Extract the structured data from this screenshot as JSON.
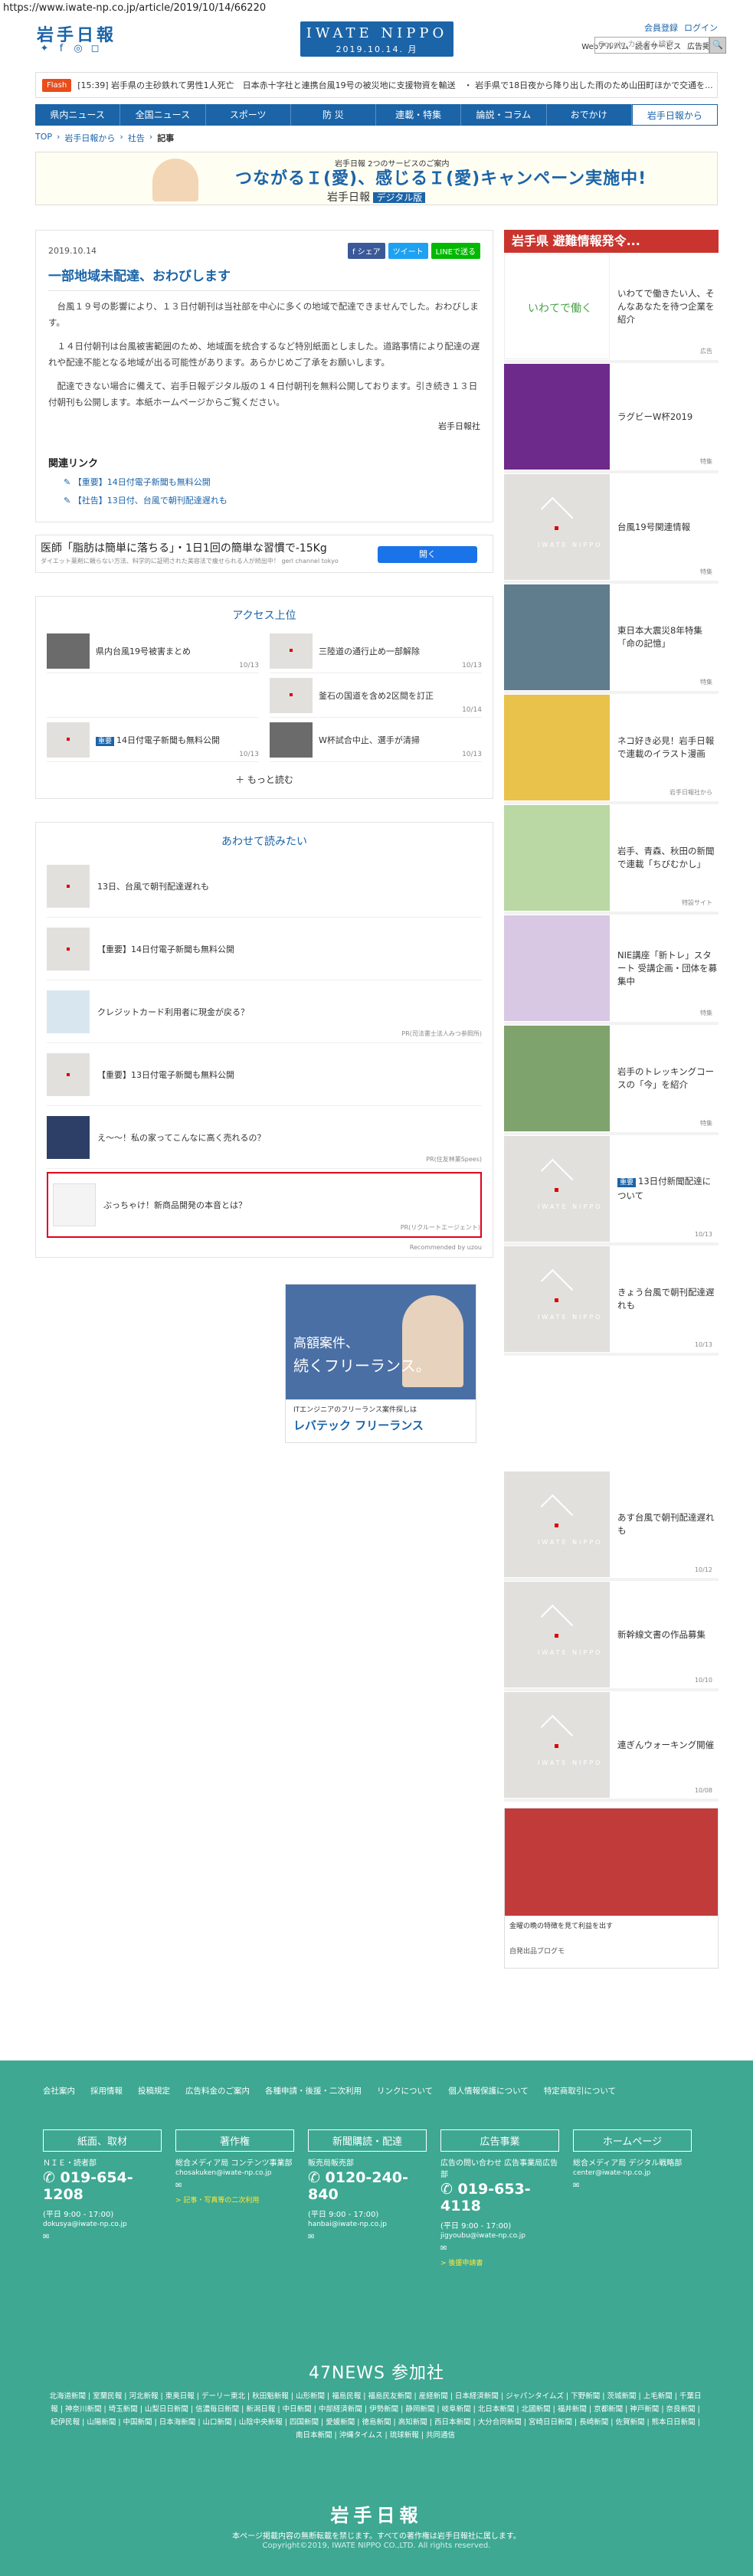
{
  "url": "https://www.iwate-np.co.jp/article/2019/10/14/66220",
  "header": {
    "logo_text": "岩手日報",
    "center_title": "IWATE NIPPO",
    "center_date": "2019.10.14. 月",
    "top_links": [
      "会員登録",
      "ログイン"
    ],
    "sub_links": [
      "Webアルバム",
      "読者サービス",
      "広告掲載"
    ],
    "search_placeholder": "Google カスタム検索",
    "search_button": "🔍"
  },
  "flash": {
    "label": "Flash",
    "text": "[15:39] 岩手県の主砂鉄れて男性1人死亡　日本赤十字社と連携台風19号の被災地に支援物資を輸送　・ 岩手県で18日夜から降り出した雨のため山田町ほかで交通を..."
  },
  "nav": {
    "items": [
      "県内ニュース",
      "全国ニュース",
      "スポーツ",
      "防 災",
      "連載・特集",
      "論説・コラム",
      "おでかけ",
      "岩手日報から"
    ],
    "active_index": 7
  },
  "breadcrumb": [
    "TOP",
    "岩手日報から",
    "社告",
    "記事"
  ],
  "banner": {
    "small": "岩手日報 2つのサービスのご案内",
    "main": "つながるＩ(愛)、感じるＩ(愛)キャンペーン実施中!",
    "sub_logo": "岩手日報",
    "sub_tag": "デジタル版"
  },
  "article": {
    "date": "2019.10.14",
    "share": [
      "f シェア",
      "ツイート",
      "LINEで送る"
    ],
    "title": "一部地域未配達、おわびします",
    "paragraphs": [
      "台風１９号の影響により、１３日付朝刊は当社部を中心に多くの地域で配達できませんでした。おわびします。",
      "１４日付朝刊は台風被害範囲のため、地域面を統合するなど特別紙面としました。道路事情により配達の遅れや配達不能となる地域が出る可能性があります。あらかじめご了承をお願いします。",
      "配達できない場合に備えて、岩手日報デジタル版の１４日付朝刊を無料公開しております。引き続き１３日付朝刊も公開します。本紙ホームページからご覧ください。"
    ],
    "signature": "岩手日報社",
    "related_title": "関連リンク",
    "related": [
      "【重要】14日付電子新聞も無料公開",
      "【社告】13日付、台風で朝刊配達遅れも"
    ]
  },
  "ad_strip": {
    "headline": "医師「脂肪は簡単に落ちる」・1日1回の簡単な習慣で-15Kg",
    "sub": "ダイエット薬剤に頼らない方法、科学的に証明された美容法で痩せられる人が続出中！ gerl channel tokyo",
    "button": "開く"
  },
  "access": {
    "title": "アクセス上位",
    "items": [
      {
        "text": "県内台風19号被害まとめ",
        "date": "10/13"
      },
      {
        "text": "三陸道の通行止め一部解除",
        "date": "10/13"
      },
      {
        "text": "",
        "date": ""
      },
      {
        "text": "釜石の国道を含め2区間を訂正",
        "date": "10/14"
      },
      {
        "text": "14日付電子新聞も無料公開",
        "date": "10/13",
        "badge": "重要"
      },
      {
        "text": "W杯試合中止、選手が清掃",
        "date": "10/13"
      }
    ],
    "more": "もっと読む"
  },
  "recommend": {
    "title": "あわせて読みたい",
    "items": [
      {
        "text": "13日、台風で朝刊配達遅れも",
        "pr": ""
      },
      {
        "text": "【重要】14日付電子新聞も無料公開",
        "pr": ""
      },
      {
        "text": "クレジットカード利用者に現金が戻る？",
        "pr": "PR(司法書士法人みつ参照所)"
      },
      {
        "text": "【重要】13日付電子新聞も無料公開",
        "pr": ""
      },
      {
        "text": "え〜〜！私の家ってこんなに高く売れるの？",
        "pr": "PR(住友林業Spees)"
      },
      {
        "text": "ぶっちゃけ！新商品開発の本音とは？",
        "pr": "PR(リクルートエージェント)"
      }
    ],
    "by": "Recommended by uzou"
  },
  "ad_box": {
    "line1": "高額案件、",
    "line2": "続くフリーランス。",
    "mid": "ITエンジニアのフリーランス案件探しは",
    "brand": "レバテック フリーランス"
  },
  "right": {
    "head": "岩手県 避難情報発令...",
    "items": [
      {
        "text": "いわてで働きたい人、そんなあなたを待つ企業を紹介",
        "cat": "広告"
      },
      {
        "text": "ラグビーW杯2019",
        "cat": "特集"
      },
      {
        "text": "台風19号関連情報",
        "cat": "特集"
      },
      {
        "text": "東日本大震災8年特集「命の記憶」",
        "cat": "特集"
      },
      {
        "text": "ネコ好き必見！岩手日報で連載のイラスト漫画",
        "cat": "岩手日報社から"
      },
      {
        "text": "岩手、青森、秋田の新聞で連載「ちびむかし」",
        "cat": "特設サイト"
      },
      {
        "text": "NIE講座「新トレ」スタート 受講企画・団体を募集中",
        "cat": "特集"
      },
      {
        "text": "岩手のトレッキングコースの「今」を紹介",
        "cat": "特集"
      },
      {
        "text": "13日付新聞配達について",
        "cat": "10/13",
        "badge": "重要"
      },
      {
        "text": "きょう台風で朝刊配達遅れも",
        "cat": "10/13"
      },
      {
        "text": "あす台風で朝刊配達遅れも",
        "cat": "10/12"
      },
      {
        "text": "新幹線文書の作品募集",
        "cat": "10/10"
      },
      {
        "text": "連ぎんウォーキング開催",
        "cat": "10/08"
      }
    ],
    "ad_caption": "金曜の晩の特徴を見て利益を出す",
    "ad_src": "自発出品ブログモ"
  },
  "footer": {
    "links": [
      "会社案内",
      "採用情報",
      "投稿規定",
      "広告料金のご案内",
      "各種申請・後援・二次利用",
      "リンクについて",
      "個人情報保護について",
      "特定商取引について"
    ],
    "cols": [
      {
        "head": "紙面、取材",
        "l1": "ＮＩＥ・読者部",
        "tel": "019-654-1208",
        "hours": "(平日 9:00 - 17:00)",
        "mail": "dokusya@iwate-np.co.jp",
        "note": ""
      },
      {
        "head": "著作権",
        "l1": "総合メディア局 コンテンツ事業部",
        "tel": "",
        "hours": "",
        "mail": "chosakuken@iwate-np.co.jp",
        "note": "> 記事・写真等の二次利用"
      },
      {
        "head": "新聞購読・配達",
        "l1": "販売局販売部",
        "tel": "0120-240-840",
        "hours": "(平日 9:00 - 17:00)",
        "mail": "hanbai@iwate-np.co.jp",
        "note": ""
      },
      {
        "head": "広告事業",
        "l1": "広告の問い合わせ 広告事業局広告部",
        "tel": "019-653-4118",
        "hours": "(平日 9:00 - 17:00)",
        "mail": "jigyoubu@iwate-np.co.jp",
        "note": "> 後援申請書"
      },
      {
        "head": "ホームページ",
        "l1": "総合メディア局 デジタル戦略部",
        "tel": "",
        "hours": "",
        "mail": "center@iwate-np.co.jp",
        "note": ""
      }
    ],
    "n47_title": "47NEWS 参加社",
    "n47_list": "北海道新聞 | 室蘭民報 | 河北新報 | 東奥日報 | デーリー東北 | 秋田魁新報 | 山形新聞 | 福島民報 | 福島民友新聞 | 産経新聞 | 日本経済新聞 | ジャパンタイムズ | 下野新聞 | 茨城新聞 | 上毛新聞 | 千葉日報 | 神奈川新聞 | 埼玉新聞 | 山梨日日新聞 | 信濃毎日新聞 | 新潟日報 | 中日新聞 | 中部経済新聞 | 伊勢新聞 | 静岡新聞 | 岐阜新聞 | 北日本新聞 | 北國新聞 | 福井新聞 | 京都新聞 | 神戸新聞 | 奈良新聞 | 紀伊民報 | 山陽新聞 | 中国新聞 | 日本海新聞 | 山口新聞 | 山陰中央新報 | 四国新聞 | 愛媛新聞 | 徳島新聞 | 高知新聞 | 西日本新聞 | 大分合同新聞 | 宮崎日日新聞 | 長崎新聞 | 佐賀新聞 | 熊本日日新聞 | 南日本新聞 | 沖縄タイムス | 琉球新報 | 共同通信",
    "logo": "岩手日報",
    "note": "本ページ掲載内容の無断転載を禁じます。すべての著作権は岩手日報社に属します。",
    "copyright": "Copyright©2019, IWATE NIPPO CO.,LTD. All rights reserved."
  }
}
